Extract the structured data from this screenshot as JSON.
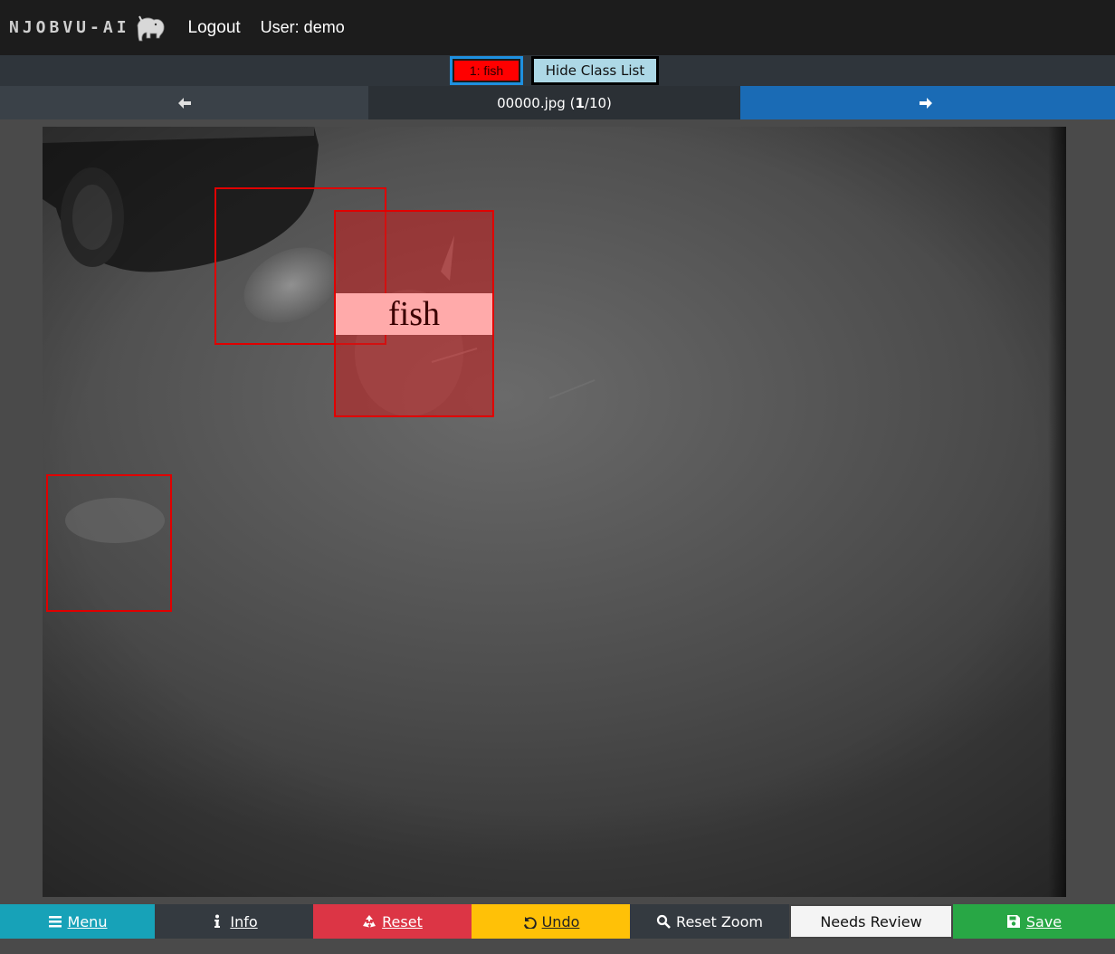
{
  "navbar": {
    "logo_text": "NJOBVU-AI",
    "logout_label": "Logout",
    "user_label": "User: demo"
  },
  "classbar": {
    "active_class_label": "1: fish",
    "active_class_color": "#ff0000",
    "hide_class_list_label": "Hide Class List"
  },
  "image_nav": {
    "prev_icon": "arrow-left-icon",
    "filename": "00000.jpg",
    "index": "1",
    "total": "10",
    "next_icon": "arrow-right-icon"
  },
  "annotations": [
    {
      "label": "",
      "selected": false
    },
    {
      "label": "fish",
      "selected": true
    },
    {
      "label": "",
      "selected": false
    }
  ],
  "toolbar": {
    "menu_label": "Menu",
    "info_label": "Info",
    "reset_label": "Reset",
    "undo_label": "Undo",
    "reset_zoom_label": "Reset Zoom",
    "needs_review_label": "Needs Review",
    "save_label": "Save"
  },
  "colors": {
    "menu": "#17a2b8",
    "reset": "#dc3545",
    "undo": "#ffc107",
    "save": "#28a745",
    "next": "#1a6bb5",
    "bbox": "#e00000"
  }
}
